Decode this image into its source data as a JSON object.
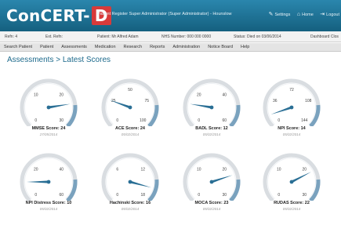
{
  "header": {
    "logo_main": "ConCERT-",
    "logo_accent": "D",
    "register_text": "Patient Register Super Administrator (Super Administrator) - Hounslow",
    "links": [
      {
        "icon": "settings-icon",
        "glyph": "✎",
        "label": "Settings"
      },
      {
        "icon": "home-icon",
        "glyph": "⌂",
        "label": "Home"
      },
      {
        "icon": "logout-icon",
        "glyph": "⇥",
        "label": "Logout"
      }
    ]
  },
  "patient_bar": {
    "refn": "Refn: 4",
    "ext_refn": "Ext. Refn:",
    "patient": "Patient: Mr Alfred Adam",
    "nhs": "NHS Number: 000 000 0000",
    "status": "Status: Died on 03/06/2014",
    "right": "Dashboard  Clos"
  },
  "nav": [
    "Search Patient",
    "Patient",
    "Assessments",
    "Medication",
    "Research",
    "Reports",
    "Administration",
    "Notice Board",
    "Help"
  ],
  "page_title": "Assessments > Latest Scores",
  "colors": {
    "header": "#1a6b8f",
    "accent": "#d83a3a",
    "gauge": "#2a6f95",
    "arc": "#7aa2be"
  },
  "gauges": [
    {
      "label": "MMSE Score: 24",
      "date": "27/05/2014",
      "max": 30,
      "value": 24,
      "ticks": [
        "0",
        "10",
        "20",
        "30"
      ]
    },
    {
      "label": "ACE Score: 24",
      "date": "05/02/2014",
      "max": 100,
      "value": 24,
      "ticks": [
        "0",
        "25",
        "50",
        "75",
        "100"
      ]
    },
    {
      "label": "BADL Score: 12",
      "date": "05/02/2014",
      "max": 60,
      "value": 12,
      "ticks": [
        "0",
        "20",
        "40",
        "60"
      ]
    },
    {
      "label": "NPI Score: 14",
      "date": "05/02/2014",
      "max": 144,
      "value": 14,
      "ticks": [
        "0",
        "36",
        "72",
        "108",
        "144"
      ]
    },
    {
      "label": "NPI Distress Score: 10",
      "date": "05/02/2014",
      "max": 60,
      "value": 10,
      "ticks": [
        "0",
        "20",
        "40",
        "60"
      ]
    },
    {
      "label": "Hachinski Score: 16",
      "date": "05/02/2014",
      "max": 18,
      "value": 16,
      "ticks": [
        "0",
        "6",
        "12",
        "18"
      ]
    },
    {
      "label": "MOCA Score: 23",
      "date": "05/02/2014",
      "max": 30,
      "value": 23,
      "ticks": [
        "0",
        "10",
        "20",
        "30"
      ]
    },
    {
      "label": "RUDAS Score: 22",
      "date": "05/02/2014",
      "max": 30,
      "value": 22,
      "ticks": [
        "0",
        "10",
        "20",
        "30"
      ]
    }
  ]
}
